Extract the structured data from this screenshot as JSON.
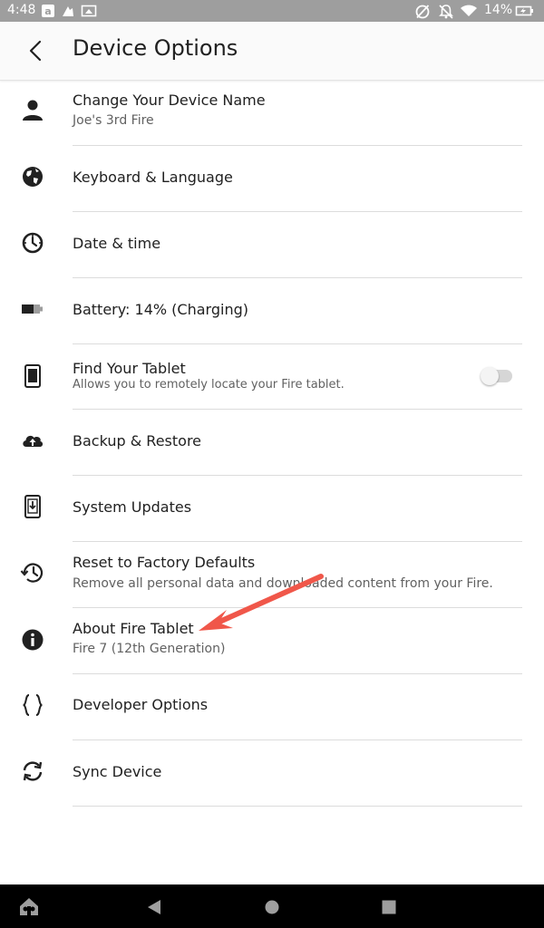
{
  "status_bar": {
    "time": "4:48",
    "battery_percent": "14%",
    "left_icons": [
      "amazon-icon",
      "kindle-icon",
      "cast-icon"
    ],
    "right_icons": [
      "no-sync-icon",
      "notifications-off-icon",
      "wifi-icon",
      "battery-charging-icon"
    ]
  },
  "header": {
    "title": "Device Options"
  },
  "settings": [
    {
      "title": "Change Your Device Name",
      "subtitle": "Joe's 3rd Fire",
      "icon": "person-icon"
    },
    {
      "title": "Keyboard  & Language",
      "icon": "globe-icon"
    },
    {
      "title": "Date & time",
      "icon": "clock-icon"
    },
    {
      "title": "Battery: 14% (Charging)",
      "icon": "battery-icon"
    },
    {
      "title": "Find Your Tablet",
      "subtitle": "Allows you to remotely locate your Fire tablet.",
      "icon": "tablet-icon",
      "toggle_on": false
    },
    {
      "title": "Backup & Restore",
      "icon": "cloud-upload-icon"
    },
    {
      "title": "System Updates",
      "icon": "system-update-icon"
    },
    {
      "title": "Reset to Factory Defaults",
      "subtitle": "Remove all personal data and downloaded content from your Fire.",
      "icon": "history-icon"
    },
    {
      "title": "About Fire Tablet",
      "subtitle": "Fire 7 (12th Generation)",
      "icon": "info-icon"
    },
    {
      "title": "Developer Options",
      "icon": "braces-icon"
    },
    {
      "title": "Sync Device",
      "icon": "sync-icon"
    }
  ],
  "nav_bar": {
    "buttons": [
      "home-icon",
      "back-icon",
      "home-circle-icon",
      "recents-icon"
    ]
  },
  "annotation": {
    "arrow_color": "#f0574a",
    "points_to": "About Fire Tablet"
  }
}
